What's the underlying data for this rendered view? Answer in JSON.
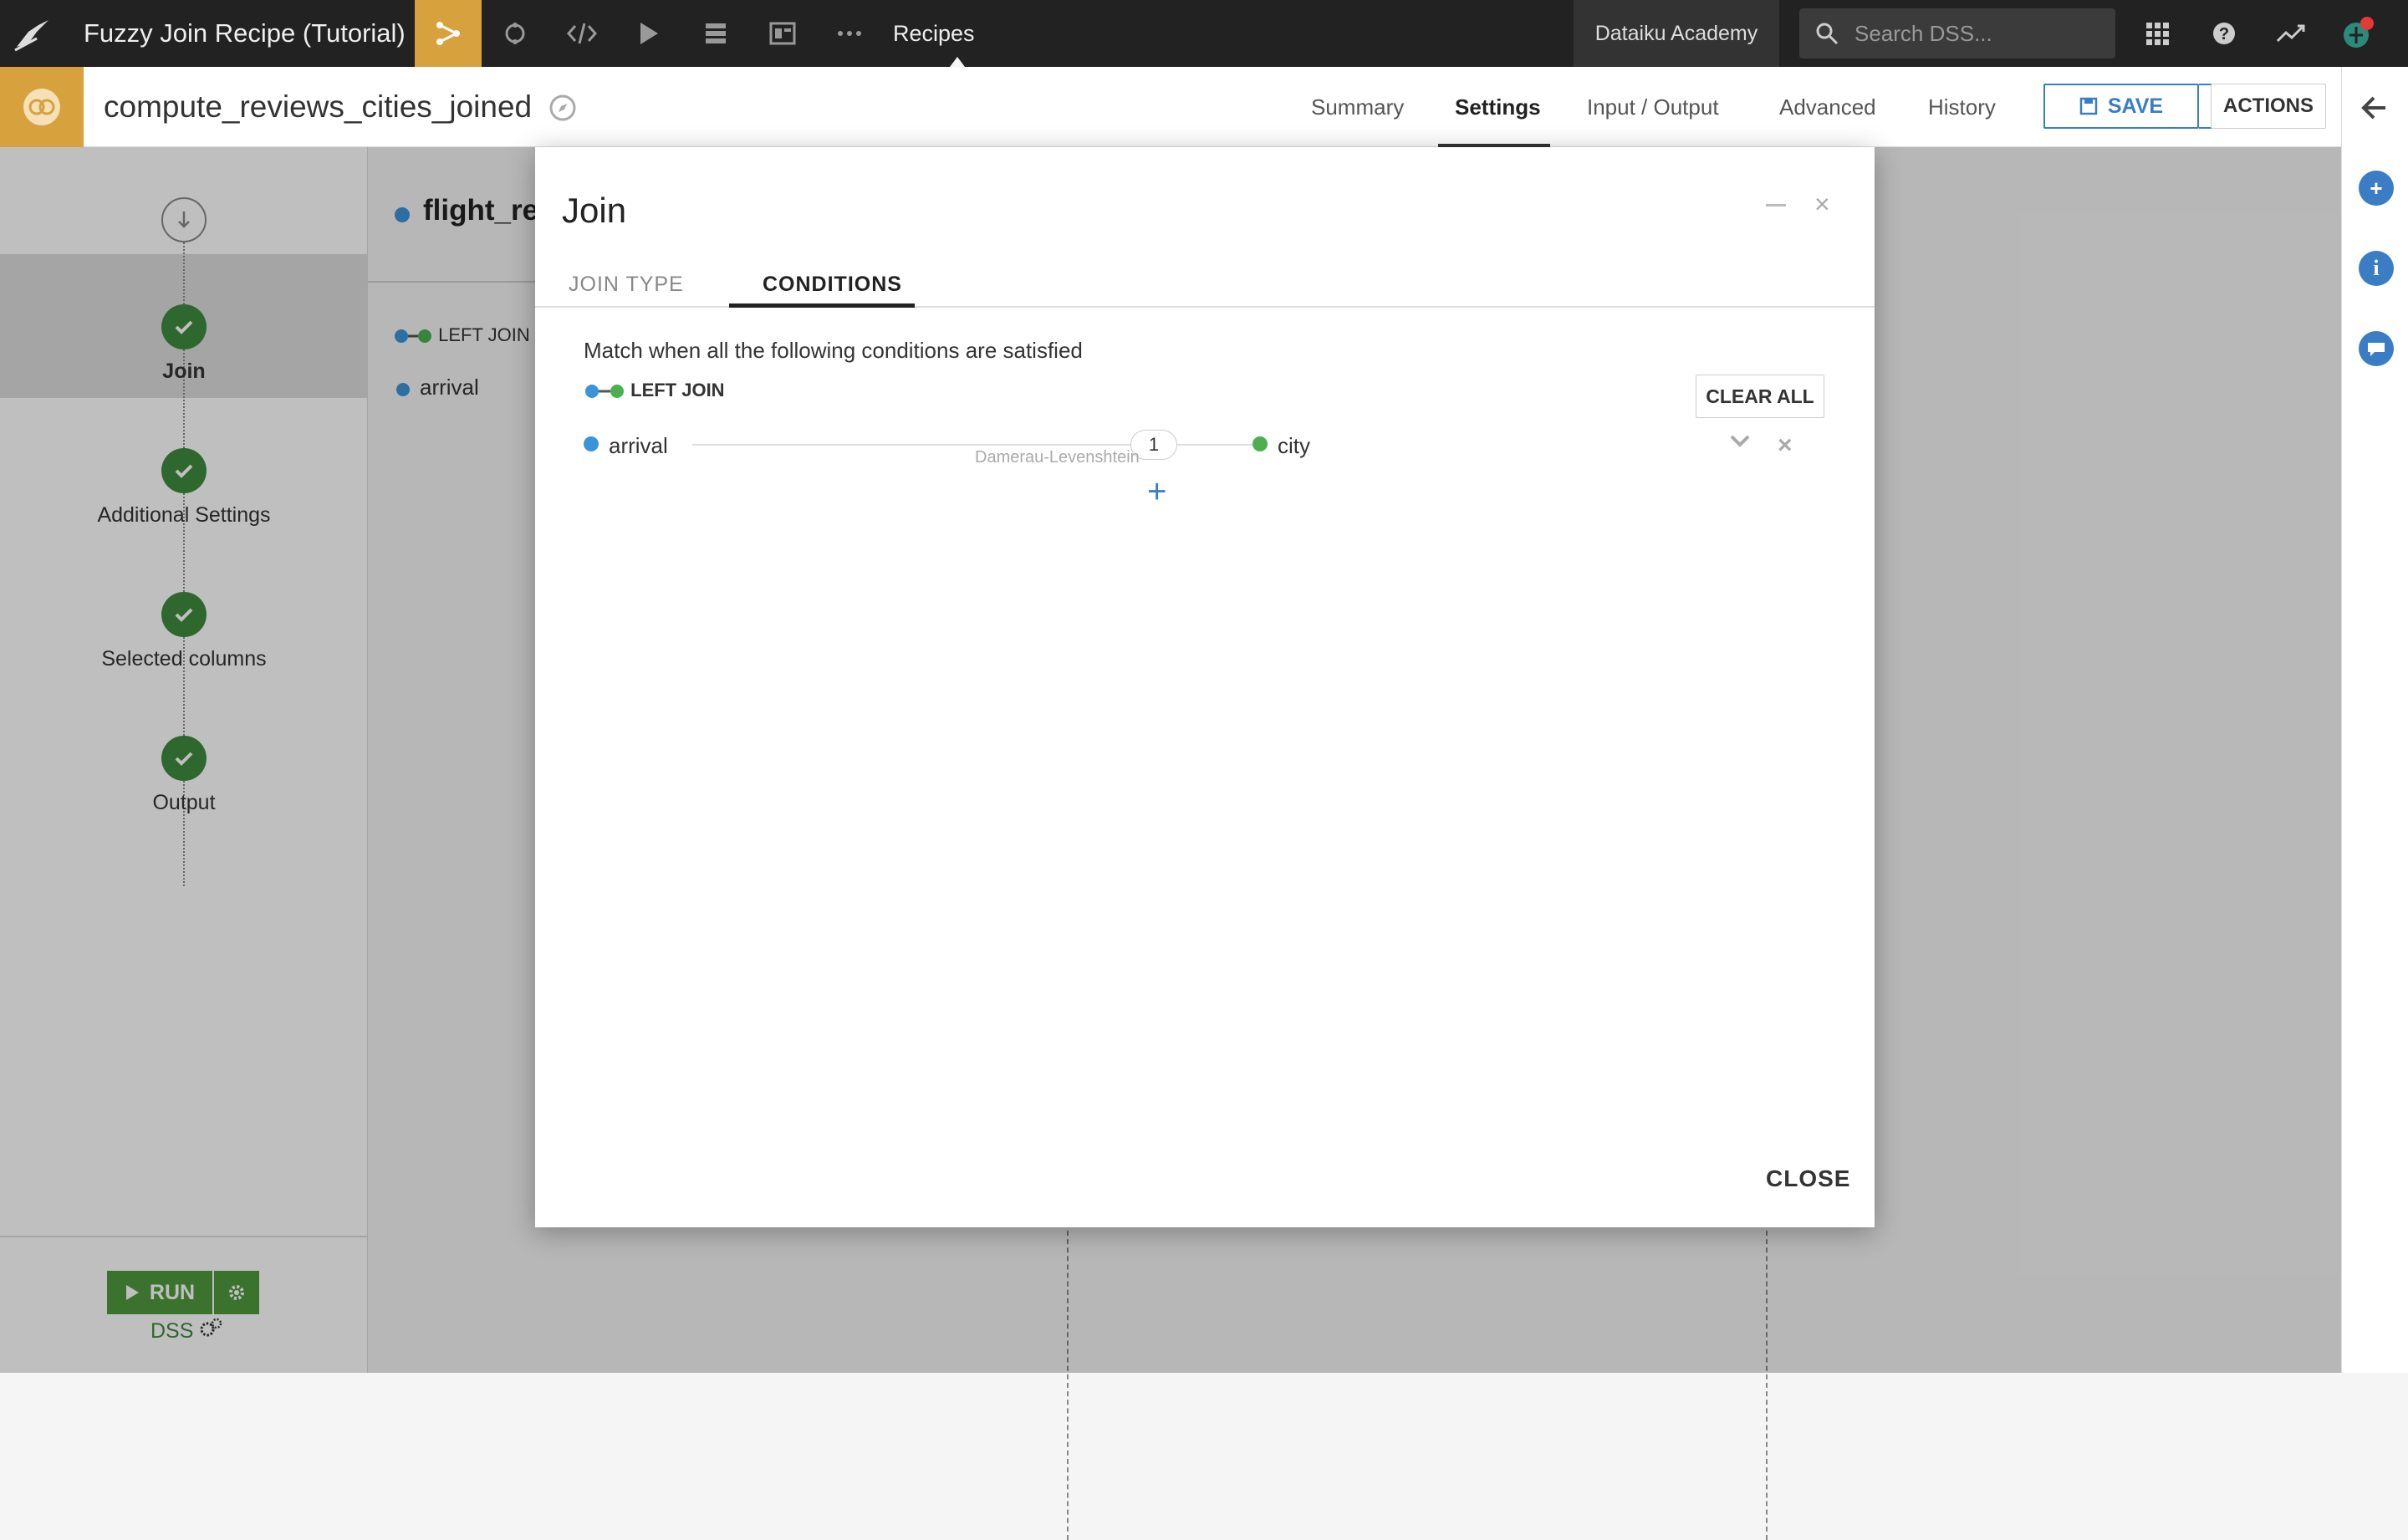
{
  "topnav": {
    "title": "Fuzzy Join Recipe (Tutorial)",
    "recipes_label": "Recipes",
    "academy_label": "Dataiku Academy",
    "search_placeholder": "Search DSS..."
  },
  "header": {
    "recipe_name": "compute_reviews_cities_joined",
    "tabs": [
      "Summary",
      "Settings",
      "Input / Output",
      "Advanced",
      "History"
    ],
    "active_tab": "Settings",
    "save_label": "SAVE",
    "actions_label": "ACTIONS"
  },
  "steps": {
    "items": [
      "Join",
      "Additional Settings",
      "Selected columns",
      "Output"
    ],
    "active": "Join",
    "run_label": "RUN",
    "engine_label": "DSS"
  },
  "background": {
    "dataset_title": "flight_re",
    "join_label": "LEFT JOIN",
    "column": "arrival"
  },
  "modal": {
    "title": "Join",
    "tabs": [
      "JOIN TYPE",
      "CONDITIONS"
    ],
    "active_tab": "CONDITIONS",
    "description": "Match when all the following conditions are satisfied",
    "join_type": "LEFT JOIN",
    "clear_all_label": "CLEAR ALL",
    "condition": {
      "left_column": "arrival",
      "right_column": "city",
      "distance": "1",
      "algorithm": "Damerau-Levenshtein"
    },
    "add_label": "+",
    "close_label": "CLOSE"
  },
  "colors": {
    "accent": "#d7a13d",
    "left_dataset": "#3b94d9",
    "right_dataset": "#4caf50",
    "step_done": "#3e8b3e",
    "primary": "#3b7dc4"
  }
}
